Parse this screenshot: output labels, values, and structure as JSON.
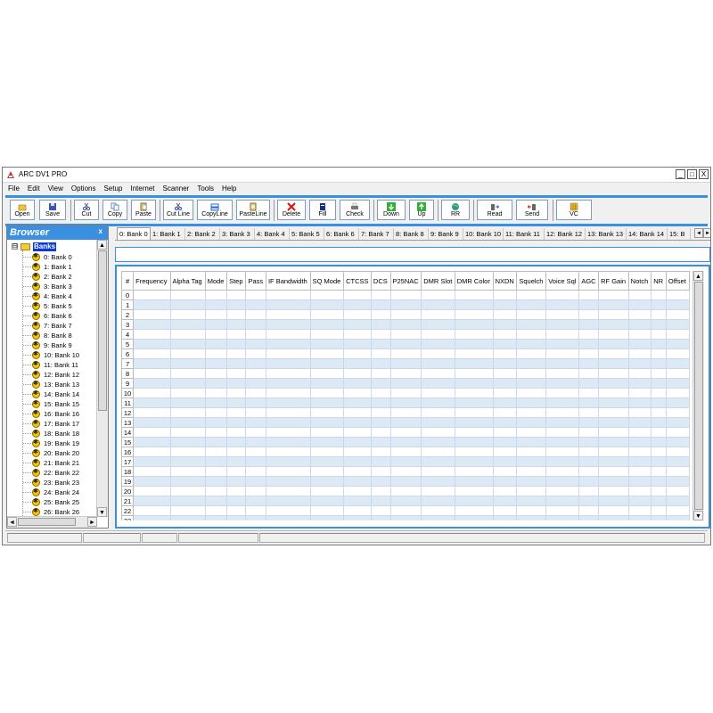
{
  "window": {
    "title": "ARC DV1 PRO",
    "min": "_",
    "max": "□",
    "close": "X"
  },
  "menu": [
    "File",
    "Edit",
    "View",
    "Options",
    "Setup",
    "Internet",
    "Scanner",
    "Tools",
    "Help"
  ],
  "toolbar": {
    "open": "Open",
    "save": "Save",
    "cut": "Cut",
    "copy": "Copy",
    "paste": "Paste",
    "cut_line": "Cut Line",
    "copy_line": "CopyLine",
    "paste_line": "PasteLine",
    "delete": "Delete",
    "fill": "Fill",
    "check": "Check",
    "down": "Down",
    "up": "Up",
    "rr": "RR",
    "read": "Read",
    "send": "Send",
    "vc": "VC"
  },
  "browser": {
    "title": "Browser",
    "close": "x",
    "root_expander": "⊟",
    "root": "Banks",
    "items": [
      "0: Bank 0",
      "1: Bank 1",
      "2: Bank 2",
      "3: Bank 3",
      "4: Bank 4",
      "5: Bank 5",
      "6: Bank 6",
      "7: Bank 7",
      "8: Bank 8",
      "9: Bank 9",
      "10: Bank 10",
      "11: Bank 11",
      "12: Bank 12",
      "13: Bank 13",
      "14: Bank 14",
      "15: Bank 15",
      "16: Bank 16",
      "17: Bank 17",
      "18: Bank 18",
      "19: Bank 19",
      "20: Bank 20",
      "21: Bank 21",
      "22: Bank 22",
      "23: Bank 23",
      "24: Bank 24",
      "25: Bank 25",
      "26: Bank 26"
    ],
    "scroll_up": "▲",
    "scroll_down": "▼",
    "scroll_left": "◄",
    "scroll_right": "►"
  },
  "tabs": [
    "0: Bank 0",
    "1: Bank 1",
    "2: Bank 2",
    "3: Bank 3",
    "4: Bank 4",
    "5: Bank 5",
    "6: Bank 6",
    "7: Bank 7",
    "8: Bank 8",
    "9: Bank 9",
    "10: Bank 10",
    "11: Bank 11",
    "12: Bank 12",
    "13: Bank 13",
    "14: Bank 14",
    "15: B"
  ],
  "tab_arrows": [
    "◄",
    "►"
  ],
  "grid": {
    "columns": [
      "#",
      "Frequency",
      "Alpha Tag",
      "Mode",
      "Step",
      "Pass",
      "IF Bandwidth",
      "SQ Mode",
      "CTCSS",
      "DCS",
      "P25NAC",
      "DMR Slot",
      "DMR Color",
      "NXDN",
      "Squelch",
      "Voice Sql",
      "AGC",
      "RF Gain",
      "Notch",
      "NR",
      "Offset"
    ],
    "rows": [
      "0",
      "1",
      "2",
      "3",
      "4",
      "5",
      "6",
      "7",
      "8",
      "9",
      "10",
      "11",
      "12",
      "13",
      "14",
      "15",
      "16",
      "17",
      "18",
      "19",
      "20",
      "21",
      "22",
      "23"
    ],
    "scroll_up": "▲",
    "scroll_down": "▼"
  },
  "colors": {
    "accent": "#3a8fe0",
    "selection": "#0a3bd6",
    "row_alt": "#dde9f5"
  }
}
